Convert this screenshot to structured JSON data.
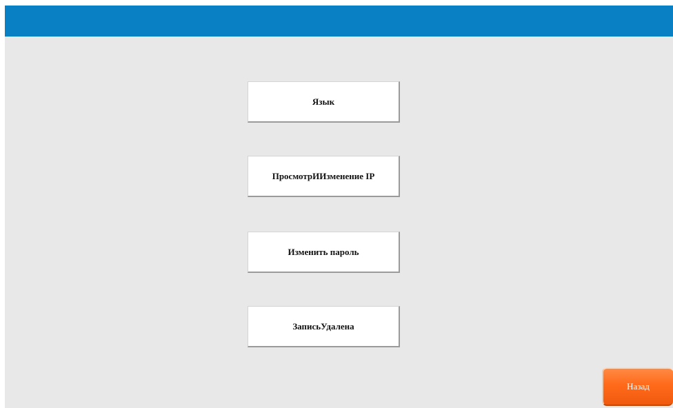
{
  "menu": {
    "items": [
      {
        "label": "Язык"
      },
      {
        "label": "ПросмотрИИзменение IP"
      },
      {
        "label": "Изменить пароль"
      },
      {
        "label": "ЗаписьУдалена"
      }
    ]
  },
  "footer": {
    "back_label": "Назад"
  },
  "colors": {
    "header": "#0a80c4",
    "background": "#e8e8e8",
    "back_button": "#ff6a1a"
  }
}
